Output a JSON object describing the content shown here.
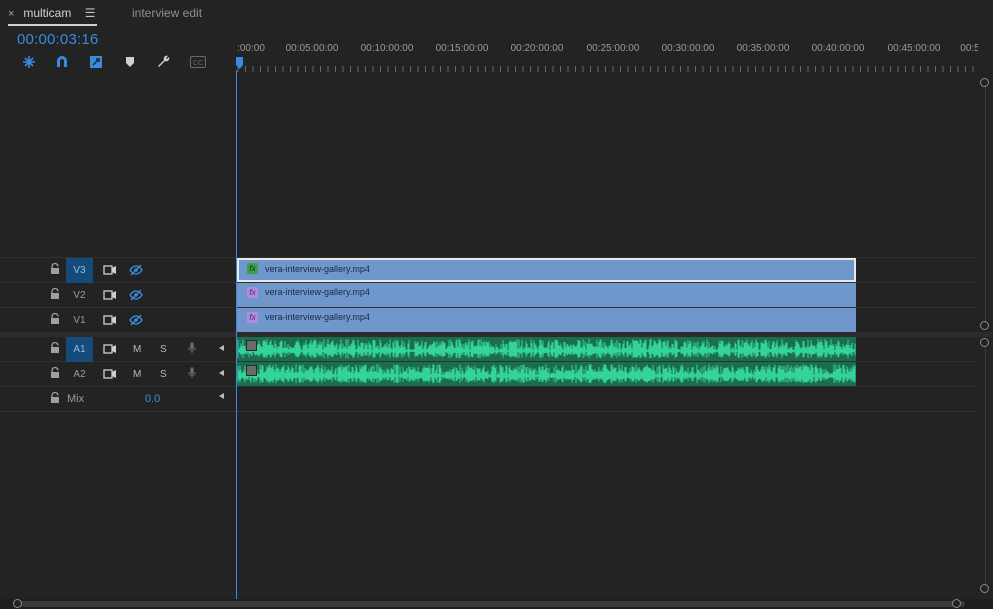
{
  "tabs": [
    {
      "label": "multicam",
      "active": true
    },
    {
      "label": "interview edit",
      "active": false
    }
  ],
  "icons": {
    "tab_close": "×",
    "tab_menu": "☰"
  },
  "timecode": "00:00:03:16",
  "ruler": {
    "labels": [
      ":00:00",
      "00:05:00:00",
      "00:10:00:00",
      "00:15:00:00",
      "00:20:00:00",
      "00:25:00:00",
      "00:30:00:00",
      "00:35:00:00",
      "00:40:00:00",
      "00:45:00:00",
      "00:5"
    ]
  },
  "tracks": {
    "video": [
      {
        "name": "V3"
      },
      {
        "name": "V2"
      },
      {
        "name": "V1"
      }
    ],
    "audio": [
      {
        "name": "A1",
        "mute": "M",
        "solo": "S"
      },
      {
        "name": "A2",
        "mute": "M",
        "solo": "S"
      }
    ],
    "mix": {
      "label": "Mix",
      "value": "0.0"
    }
  },
  "clips": {
    "v3": "vera-interview-gallery.mp4",
    "v2": "vera-interview-gallery.mp4",
    "v1": "vera-interview-gallery.mp4"
  },
  "colors": {
    "accent": "#3a8bdf",
    "video_clip": "#6f97cc",
    "audio_clip": "#1b6d4f",
    "waveform": "#34d39a",
    "track_target": "#154b7a"
  }
}
